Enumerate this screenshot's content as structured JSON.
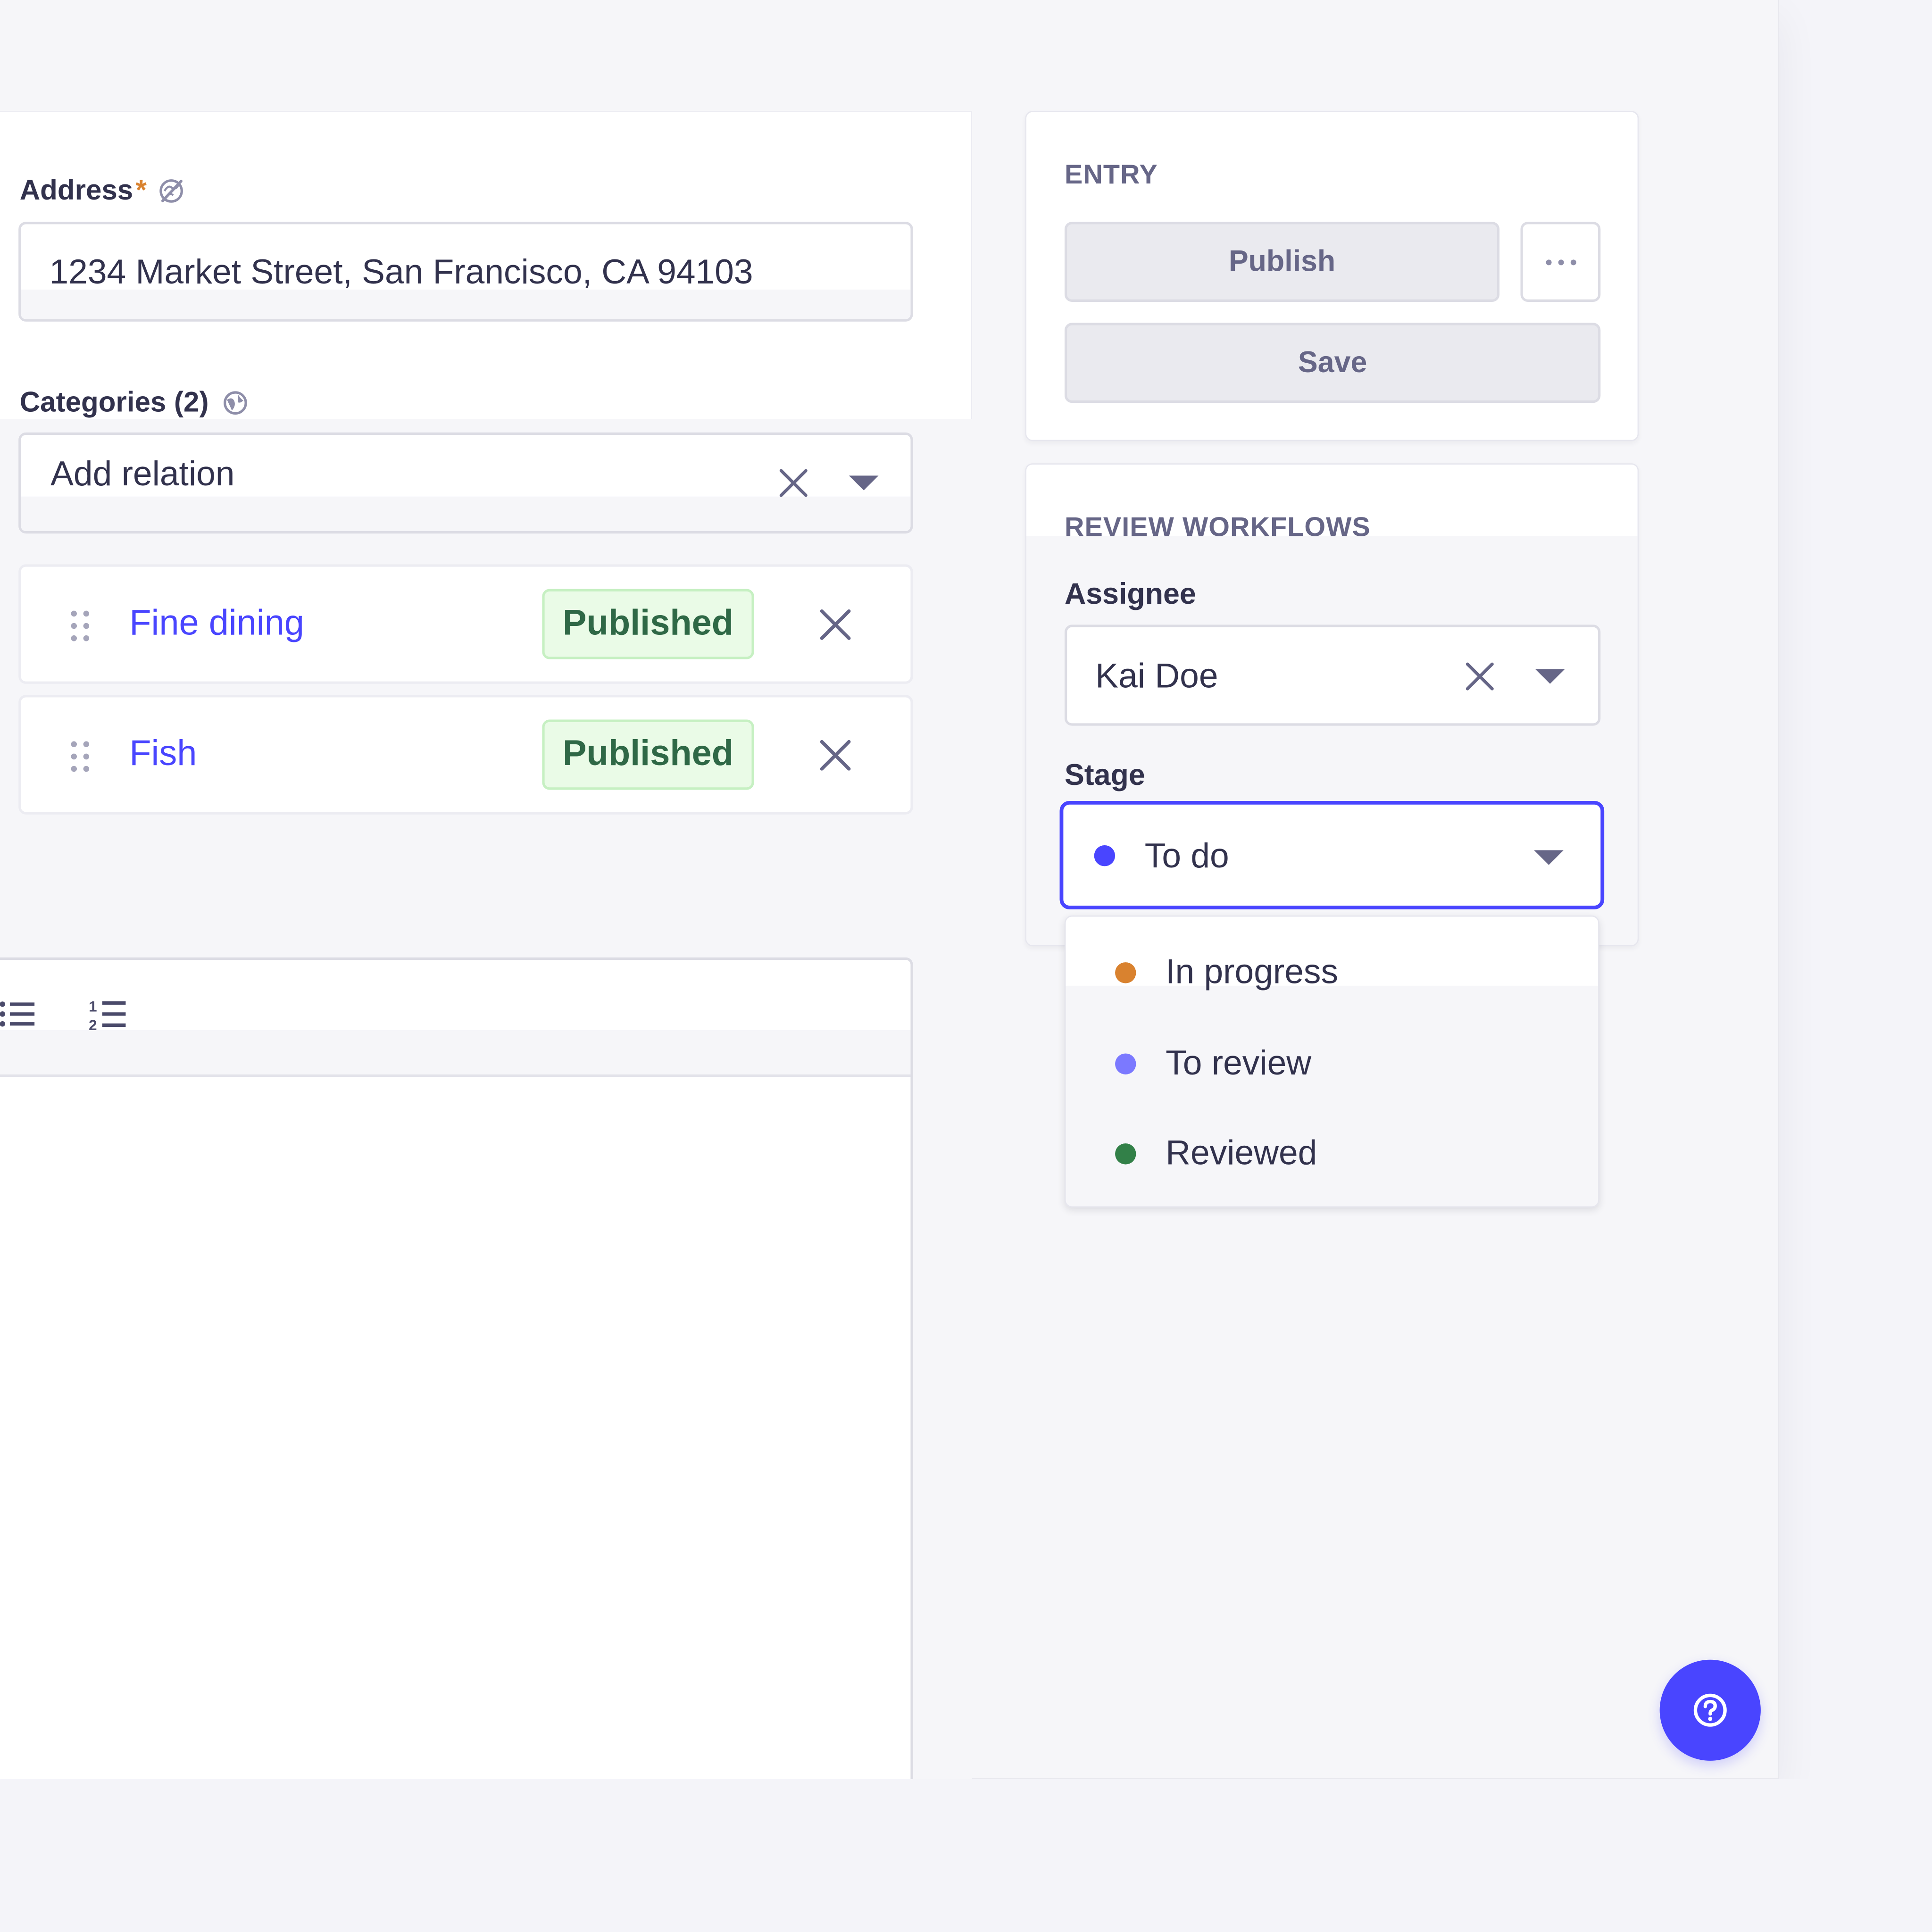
{
  "fields": {
    "address": {
      "label": "Address",
      "required_marker": "*",
      "value": "1234 Market Street, San Francisco, CA 94103"
    },
    "categories": {
      "label": "Categories (2)",
      "placeholder": "Add relation",
      "relations": [
        {
          "name": "Fine dining",
          "status": "Published"
        },
        {
          "name": "Fish",
          "status": "Published"
        }
      ]
    }
  },
  "sidebar": {
    "entry": {
      "title": "ENTRY",
      "publish_label": "Publish",
      "save_label": "Save"
    },
    "review_workflows": {
      "title": "REVIEW WORKFLOWS",
      "assignee_label": "Assignee",
      "assignee_value": "Kai Doe",
      "stage_label": "Stage",
      "stage_value": "To do",
      "stage_color": "#4945ff",
      "stage_options": [
        {
          "label": "In progress",
          "color": "#d9822f"
        },
        {
          "label": "To review",
          "color": "#7b79ff"
        },
        {
          "label": "Reviewed",
          "color": "#328048"
        }
      ]
    }
  },
  "colors": {
    "primary": "#4945ff",
    "success_text": "#2f6846",
    "success_bg": "#eafbe7",
    "required": "#d9822f"
  },
  "icons": {
    "address_label_icon": "globe-disabled-icon",
    "categories_label_icon": "globe-icon",
    "toolbar": [
      "bulleted-list-icon",
      "numbered-list-icon"
    ],
    "help": "help-circle-icon"
  }
}
